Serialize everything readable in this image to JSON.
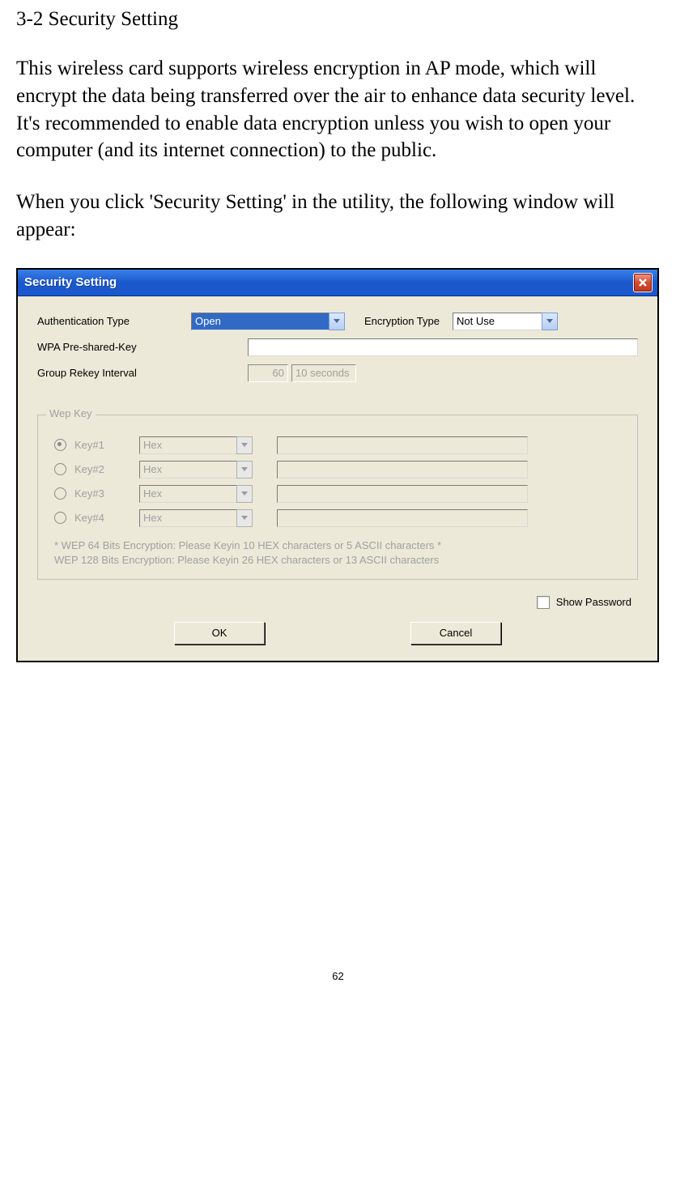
{
  "doc": {
    "heading": "3-2 Security Setting",
    "para1": "This wireless card supports wireless encryption in AP mode, which will encrypt the data being transferred over the air to enhance data security level. It's recommended to enable data encryption unless you wish to open your computer (and its internet connection) to the public.",
    "para2": "When you click 'Security Setting' in the utility, the following window will appear:",
    "page_number": "62"
  },
  "dialog": {
    "title": "Security Setting",
    "auth_label": "Authentication Type",
    "auth_value": "Open",
    "enc_label": "Encryption Type",
    "enc_value": "Not Use",
    "wpa_label": "WPA Pre-shared-Key",
    "wpa_value": "",
    "rekey_label": "Group Rekey Interval",
    "rekey_value": "60",
    "rekey_unit": "10 seconds",
    "wep_group_title": "Wep Key",
    "wep_keys": [
      {
        "label": "Key#1",
        "type": "Hex",
        "value": "",
        "checked": true
      },
      {
        "label": "Key#2",
        "type": "Hex",
        "value": "",
        "checked": false
      },
      {
        "label": "Key#3",
        "type": "Hex",
        "value": "",
        "checked": false
      },
      {
        "label": "Key#4",
        "type": "Hex",
        "value": "",
        "checked": false
      }
    ],
    "hint_line1": "* WEP 64 Bits Encryption:  Please Keyin 10 HEX characters or 5 ASCII characters *",
    "hint_line2": "WEP 128 Bits Encryption:  Please Keyin 26 HEX characters or 13 ASCII characters",
    "show_password_label": "Show Password",
    "ok_label": "OK",
    "cancel_label": "Cancel"
  }
}
